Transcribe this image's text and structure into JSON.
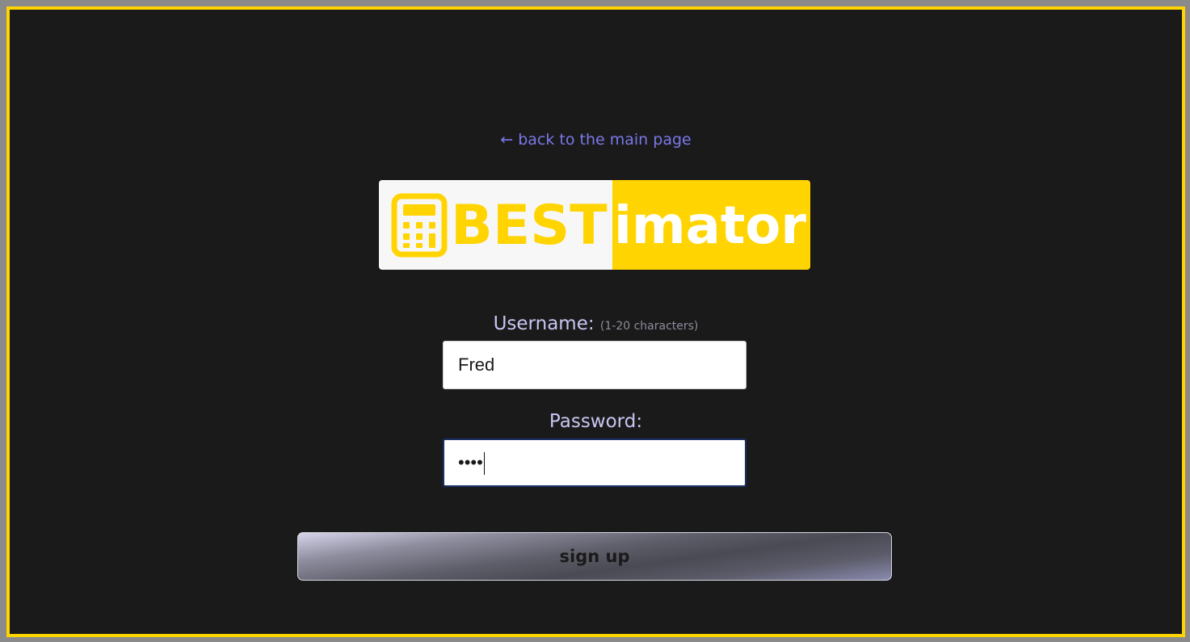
{
  "nav": {
    "back_link": "← back to the main page"
  },
  "logo": {
    "part1": "BEST",
    "part2": "imator",
    "icon": "calculator-icon"
  },
  "form": {
    "username_label": "Username:",
    "username_hint": "(1-20 characters)",
    "username_value": "Fred",
    "password_label": "Password:",
    "password_masked": "••••",
    "submit_label": "sign up"
  },
  "colors": {
    "accent": "#ffd400",
    "background": "#1a1a1a",
    "link": "#7a78e8",
    "label": "#c9c6f2"
  }
}
